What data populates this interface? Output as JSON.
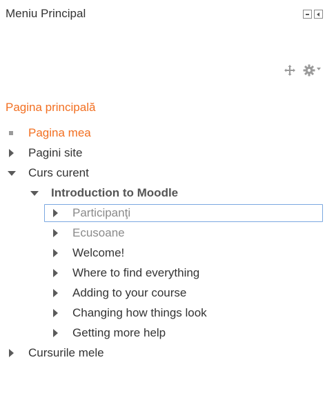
{
  "block": {
    "title": "Meniu Principal",
    "controls": {
      "hide_icon": "minus-box-icon",
      "dock_icon": "dock-left-box-icon"
    },
    "actions": {
      "move_icon": "move-cross-icon",
      "settings_icon": "gear-icon"
    }
  },
  "navigation": {
    "home": "Pagina principală",
    "items": [
      {
        "label": "Pagina mea",
        "icon": "bullet-square-icon",
        "state": "active"
      },
      {
        "label": "Pagini site",
        "icon": "caret-right-icon",
        "state": "collapsed"
      },
      {
        "label": "Curs curent",
        "icon": "caret-down-icon",
        "state": "expanded"
      }
    ],
    "course": {
      "label": "Introduction to Moodle",
      "icon": "caret-down-icon",
      "state": "expanded",
      "children": [
        {
          "label": "Participanţi",
          "icon": "caret-right-icon",
          "state": "focused"
        },
        {
          "label": "Ecusoane",
          "icon": "caret-right-icon",
          "state": "muted"
        },
        {
          "label": "Welcome!",
          "icon": "caret-right-icon",
          "state": "collapsed"
        },
        {
          "label": "Where to find everything",
          "icon": "caret-right-icon",
          "state": "collapsed"
        },
        {
          "label": "Adding to your course",
          "icon": "caret-right-icon",
          "state": "collapsed"
        },
        {
          "label": "Changing how things look",
          "icon": "caret-right-icon",
          "state": "collapsed"
        },
        {
          "label": "Getting more help",
          "icon": "caret-right-icon",
          "state": "collapsed"
        }
      ]
    },
    "my_courses": {
      "label": "Cursurile mele",
      "icon": "caret-right-icon",
      "state": "collapsed"
    }
  },
  "colors": {
    "accent": "#f26f21",
    "text": "#333333",
    "muted": "#8a8a8a",
    "focus_border": "#7aa7e0"
  }
}
